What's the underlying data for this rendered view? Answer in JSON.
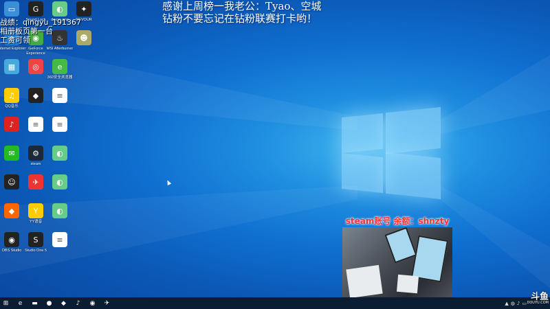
{
  "overlay": {
    "line1": "感谢上周榜一我老公：Tyao、空城",
    "line2": "钻粉不要忘记在钻粉联赛打卡哟！",
    "left_line1": "战绩：qingyu_191367",
    "left_line2": "相册板页第一台",
    "left_line3": "工资可领",
    "steam": "steam账号 余额：shnzty"
  },
  "colors": {
    "accent": "#0f6fd0",
    "taskbar": "#0b1d33",
    "banner_text": "#ff3030"
  },
  "desktop_icons": [
    {
      "label": "",
      "icon": "computer-icon",
      "color": "#3a8fd8"
    },
    {
      "label": "Sound Lock",
      "icon": "logitech-icon",
      "color": "#222"
    },
    {
      "label": "douyu.png",
      "icon": "photo-icon",
      "color": "#6c8"
    },
    {
      "label": "DEVOUR",
      "icon": "devour-icon",
      "color": "#222"
    },
    {
      "label": "Internet Explorer",
      "icon": "ie-icon",
      "color": "#1e7bd8"
    },
    {
      "label": "GeForce Experience",
      "icon": "nvidia-icon",
      "color": "#4a4"
    },
    {
      "label": "MSI Afterburner",
      "icon": "msi-icon",
      "color": "#333"
    },
    {
      "label": "",
      "icon": "game-icon",
      "color": "#aa6"
    },
    {
      "label": "",
      "icon": "image-icon",
      "color": "#4ad"
    },
    {
      "label": "",
      "icon": "chrome-icon",
      "color": "#e44"
    },
    {
      "label": "360安全浏览器",
      "icon": "browser360-icon",
      "color": "#4b4"
    },
    {
      "label": "QQ音乐",
      "icon": "qqmusic-icon",
      "color": "#fc0"
    },
    {
      "label": "",
      "icon": "app-icon",
      "color": "#222"
    },
    {
      "label": "",
      "icon": "document-icon",
      "color": "#fff"
    },
    {
      "label": "",
      "icon": "netease-icon",
      "color": "#d22"
    },
    {
      "label": "",
      "icon": "document-icon",
      "color": "#fff"
    },
    {
      "label": "",
      "icon": "document-icon",
      "color": "#fff"
    },
    {
      "label": "",
      "icon": "wechat-icon",
      "color": "#2b2"
    },
    {
      "label": "steam",
      "icon": "steam-icon",
      "color": "#1b2838"
    },
    {
      "label": "",
      "icon": "photo-icon",
      "color": "#6c8"
    },
    {
      "label": "",
      "icon": "qq-icon",
      "color": "#222"
    },
    {
      "label": "",
      "icon": "bird-icon",
      "color": "#e33"
    },
    {
      "label": "",
      "icon": "photo-icon",
      "color": "#6c8"
    },
    {
      "label": "",
      "icon": "app-icon",
      "color": "#f60"
    },
    {
      "label": "YY语音",
      "icon": "yy-icon",
      "color": "#fc0"
    },
    {
      "label": "",
      "icon": "photo-icon",
      "color": "#6c8"
    },
    {
      "label": "OBS Studio",
      "icon": "obs-icon",
      "color": "#222"
    },
    {
      "label": "Studio One 5",
      "icon": "studio-icon",
      "color": "#222"
    },
    {
      "label": "",
      "icon": "document-icon",
      "color": "#fff"
    }
  ],
  "taskbar": {
    "items": [
      "windows-start-icon",
      "edge-icon",
      "file-explorer-icon",
      "chat-icon",
      "app-icon",
      "netease-icon",
      "record-icon",
      "tool-icon"
    ]
  },
  "watermark": {
    "title": "斗鱼",
    "sub": "DOUYU.COM"
  }
}
